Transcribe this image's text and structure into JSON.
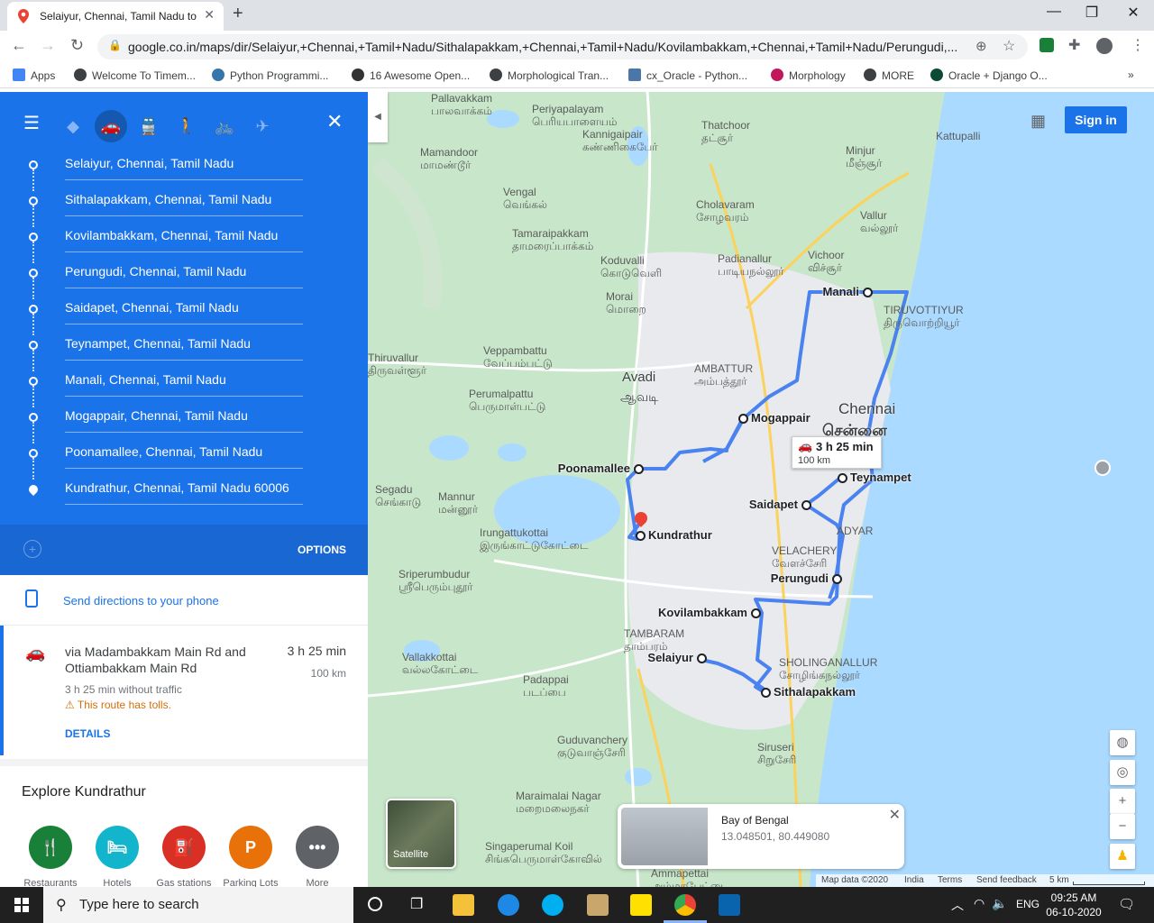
{
  "browser": {
    "tab_title": "Selaiyur, Chennai, Tamil Nadu to",
    "url": "google.co.in/maps/dir/Selaiyur,+Chennai,+Tamil+Nadu/Sithalapakkam,+Chennai,+Tamil+Nadu/Kovilambakkam,+Chennai,+Tamil+Nadu/Perungudi,...",
    "bookmarks": [
      "Apps",
      "Welcome To Timem...",
      "Python Programmi...",
      "16 Awesome Open...",
      "Morphological Tran...",
      "cx_Oracle - Python...",
      "Morphology",
      "MORE",
      "Oracle + Django O..."
    ]
  },
  "directions": {
    "waypoints": [
      "Selaiyur, Chennai, Tamil Nadu",
      "Sithalapakkam, Chennai, Tamil Nadu",
      "Kovilambakkam, Chennai, Tamil Nadu",
      "Perungudi, Chennai, Tamil Nadu",
      "Saidapet, Chennai, Tamil Nadu",
      "Teynampet, Chennai, Tamil Nadu",
      "Manali, Chennai, Tamil Nadu",
      "Mogappair, Chennai, Tamil Nadu",
      "Poonamallee, Chennai, Tamil Nadu",
      "Kundrathur, Chennai, Tamil Nadu 60006"
    ],
    "options_label": "OPTIONS",
    "send_label": "Send directions to your phone",
    "route": {
      "via": "via Madambakkam Main Rd and Ottiambakkam Main Rd",
      "time": "3 h 25 min",
      "distance": "100 km",
      "no_traffic": "3 h 25 min without traffic",
      "tolls": "This route has tolls.",
      "details": "DETAILS"
    },
    "explore_title": "Explore Kundrathur",
    "explore_items": [
      {
        "label": "Restaurants",
        "color": "#188038"
      },
      {
        "label": "Hotels",
        "color": "#12b5cb"
      },
      {
        "label": "Gas stations",
        "color": "#d93025"
      },
      {
        "label": "Parking Lots",
        "color": "#e8710a"
      },
      {
        "label": "More",
        "color": "#5f6368"
      }
    ]
  },
  "map": {
    "sign_in": "Sign in",
    "route_box": {
      "time": "3 h 25 min",
      "distance": "100 km"
    },
    "places": {
      "manali": "Manali",
      "mogappair": "Mogappair",
      "poonamallee": "Poonamallee",
      "teynampet": "Teynampet",
      "saidapet": "Saidapet",
      "kundrathur": "Kundrathur",
      "perungudi": "Perungudi",
      "kovilambakkam": "Kovilambakkam",
      "selaiyur": "Selaiyur",
      "sithalapakkam": "Sithalapakkam"
    },
    "cities": {
      "chennai": "Chennai",
      "chennai_ta": "சென்னை",
      "avadi": "Avadi",
      "avadi_ta": "ஆவடி"
    },
    "labels": [
      {
        "en": "Pallavakkam",
        "ta": "பாலவாக்கம்"
      },
      {
        "en": "Periyapalayam",
        "ta": "பெரியபாளையம்"
      },
      {
        "en": "Thatchoor",
        "ta": "தட்சூர்"
      },
      {
        "en": "Minjur",
        "ta": "மீஞ்சூர்"
      },
      {
        "en": "Kattupalli",
        "ta": ""
      },
      {
        "en": "Mamandoor",
        "ta": "மாமண்டூர்"
      },
      {
        "en": "Kannigaipair",
        "ta": "கண்ணிகைபேர்"
      },
      {
        "en": "Vengal",
        "ta": "வெங்கல்"
      },
      {
        "en": "Cholavaram",
        "ta": "சோழவரம்"
      },
      {
        "en": "Vallur",
        "ta": "வல்லூர்"
      },
      {
        "en": "Tamaraipakkam",
        "ta": "தாமரைப்பாக்கம்"
      },
      {
        "en": "Koduvalli",
        "ta": "கொடுவெளி"
      },
      {
        "en": "Padianallur",
        "ta": "பாடியநல்லூர்"
      },
      {
        "en": "Vichoor",
        "ta": "விச்சூர்"
      },
      {
        "en": "Morai",
        "ta": "மொறை"
      },
      {
        "en": "TIRUVOTTIYUR",
        "ta": "திருவொற்றியூர்"
      },
      {
        "en": "Thiruvallur",
        "ta": "திருவள்ளூர்"
      },
      {
        "en": "Veppambattu",
        "ta": "வேப்பம்பட்டு"
      },
      {
        "en": "AMBATTUR",
        "ta": "அம்பத்தூர்"
      },
      {
        "en": "Perumalpattu",
        "ta": "பெருமாள்பட்டு"
      },
      {
        "en": "Segadu",
        "ta": "செங்காடு"
      },
      {
        "en": "Mannur",
        "ta": "மன்னூர்"
      },
      {
        "en": "Irungattukottai",
        "ta": "இருங்காட்டுகோட்டை"
      },
      {
        "en": "VELACHERY",
        "ta": "வேளச்சேரி"
      },
      {
        "en": "ADYAR",
        "ta": ""
      },
      {
        "en": "Sriperumbudur",
        "ta": "ஸ்ரீபெரும்புதூர்"
      },
      {
        "en": "TAMBARAM",
        "ta": "தாம்பரம்"
      },
      {
        "en": "SHOLINGANALLUR",
        "ta": "சோழிங்கநல்லூர்"
      },
      {
        "en": "Vallakkottai",
        "ta": "வல்லகோட்டை"
      },
      {
        "en": "Padappai",
        "ta": "படப்பை"
      },
      {
        "en": "Guduvanchery",
        "ta": "குடுவாஞ்சேரி"
      },
      {
        "en": "Siruseri",
        "ta": "சிறுசேரி"
      },
      {
        "en": "Maraimalai Nagar",
        "ta": "மறைமலைநகர்"
      },
      {
        "en": "Singaperumal Koil",
        "ta": "சிங்கபெருமாள்கோவில்"
      },
      {
        "en": "Ammapettai",
        "ta": "அம்மாபேட்டை"
      }
    ],
    "satellite_label": "Satellite",
    "info_card": {
      "name": "Bay of Bengal",
      "coords": "13.048501, 80.449080"
    },
    "footer": {
      "data": "Map data ©2020",
      "india": "India",
      "terms": "Terms",
      "feedback": "Send feedback",
      "scale": "5 km"
    }
  },
  "taskbar": {
    "search_placeholder": "Type here to search",
    "lang": "ENG",
    "time": "09:25 AM",
    "date": "06-10-2020"
  }
}
